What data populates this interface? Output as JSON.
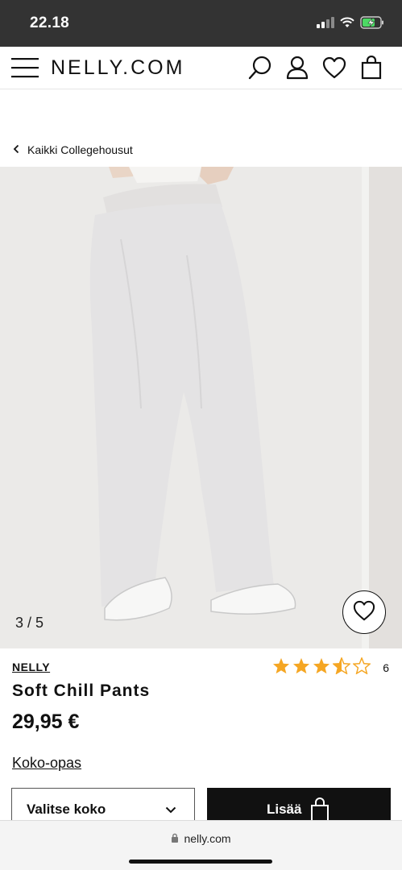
{
  "status_bar": {
    "time": "22.18"
  },
  "header": {
    "brand": "NELLY.COM"
  },
  "breadcrumb": {
    "label": "Kaikki Collegehousut"
  },
  "gallery": {
    "counter": "3 / 5"
  },
  "product": {
    "brand": "NELLY",
    "name": "Soft Chill Pants",
    "price": "29,95 €",
    "rating": {
      "value": 3.5,
      "max": 5,
      "count": "6"
    },
    "size_guide": "Koko-opas",
    "size_select": "Valitse koko",
    "add_to_cart": "Lisää"
  },
  "browser": {
    "url": "nelly.com"
  },
  "colors": {
    "status_bar_bg": "#333333",
    "star": "#f5a623",
    "primary_button": "#111111"
  }
}
